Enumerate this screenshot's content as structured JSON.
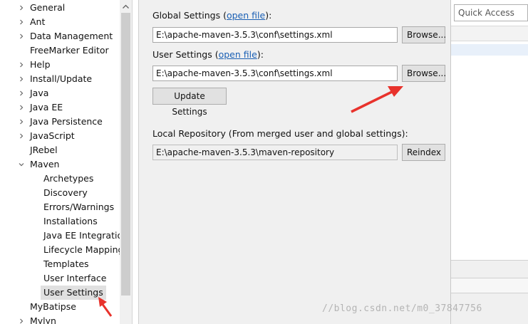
{
  "tree": {
    "items": [
      {
        "label": "General",
        "expandable": true,
        "expanded": false
      },
      {
        "label": "Ant",
        "expandable": true,
        "expanded": false
      },
      {
        "label": "Data Management",
        "expandable": true,
        "expanded": false
      },
      {
        "label": "FreeMarker Editor",
        "expandable": false,
        "expanded": false
      },
      {
        "label": "Help",
        "expandable": true,
        "expanded": false
      },
      {
        "label": "Install/Update",
        "expandable": true,
        "expanded": false
      },
      {
        "label": "Java",
        "expandable": true,
        "expanded": false
      },
      {
        "label": "Java EE",
        "expandable": true,
        "expanded": false
      },
      {
        "label": "Java Persistence",
        "expandable": true,
        "expanded": false
      },
      {
        "label": "JavaScript",
        "expandable": true,
        "expanded": false
      },
      {
        "label": "JRebel",
        "expandable": false,
        "expanded": false
      },
      {
        "label": "Maven",
        "expandable": true,
        "expanded": true
      },
      {
        "label": "Archetypes",
        "child": true
      },
      {
        "label": "Discovery",
        "child": true
      },
      {
        "label": "Errors/Warnings",
        "child": true
      },
      {
        "label": "Installations",
        "child": true
      },
      {
        "label": "Java EE Integration",
        "child": true
      },
      {
        "label": "Lifecycle Mappings",
        "child": true
      },
      {
        "label": "Templates",
        "child": true
      },
      {
        "label": "User Interface",
        "child": true
      },
      {
        "label": "User Settings",
        "child": true,
        "selected": true
      },
      {
        "label": "MyBatipse",
        "expandable": false,
        "expanded": false
      },
      {
        "label": "Mylyn",
        "expandable": true,
        "expanded": false
      }
    ]
  },
  "settings": {
    "global_label": "Global Settings (",
    "global_link": "open file",
    "global_label_end": "):",
    "global_path": "E:\\apache-maven-3.5.3\\conf\\settings.xml",
    "user_label": "User Settings (",
    "user_link": "open file",
    "user_label_end": "):",
    "user_path": "E:\\apache-maven-3.5.3\\conf\\settings.xml",
    "browse_label": "Browse...",
    "update_label": "Update Settings",
    "local_repo_label": "Local Repository (From merged user and global settings):",
    "local_repo_path": "E:\\apache-maven-3.5.3\\maven-repository",
    "reindex_label": "Reindex"
  },
  "background_window": {
    "quick_access": "Quick Access"
  },
  "watermark": "//blog.csdn.net/m0_37847756",
  "colors": {
    "annotation_arrow": "#e8322c",
    "link": "#1a5fb4",
    "panel_bg": "#f0f0f0"
  }
}
